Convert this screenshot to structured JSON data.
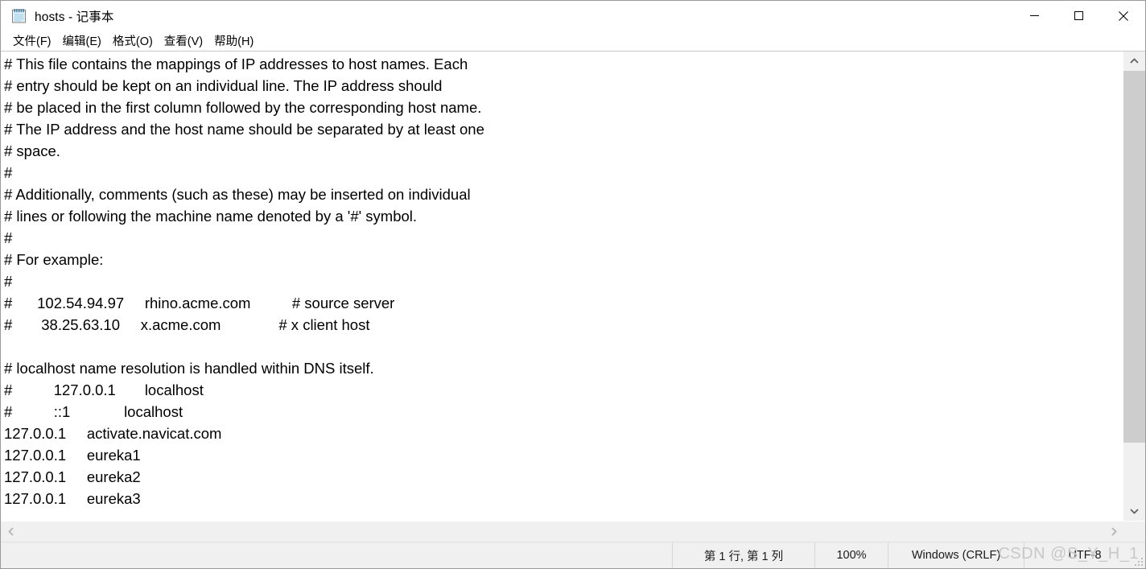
{
  "window": {
    "title": "hosts - 记事本",
    "icon": "notepad-icon",
    "controls": {
      "minimize": "—",
      "maximize": "□",
      "close": "✕"
    }
  },
  "menubar": {
    "items": [
      {
        "label": "文件(F)",
        "name": "menu-file"
      },
      {
        "label": "编辑(E)",
        "name": "menu-edit"
      },
      {
        "label": "格式(O)",
        "name": "menu-format"
      },
      {
        "label": "查看(V)",
        "name": "menu-view"
      },
      {
        "label": "帮助(H)",
        "name": "menu-help"
      }
    ]
  },
  "editor": {
    "lines": [
      "# This file contains the mappings of IP addresses to host names. Each",
      "# entry should be kept on an individual line. The IP address should",
      "# be placed in the first column followed by the corresponding host name.",
      "# The IP address and the host name should be separated by at least one",
      "# space.",
      "#",
      "# Additionally, comments (such as these) may be inserted on individual",
      "# lines or following the machine name denoted by a '#' symbol.",
      "#",
      "# For example:",
      "#",
      "#      102.54.94.97     rhino.acme.com          # source server",
      "#       38.25.63.10     x.acme.com              # x client host",
      "",
      "# localhost name resolution is handled within DNS itself.",
      "#          127.0.0.1       localhost",
      "#          ::1             localhost",
      "127.0.0.1     activate.navicat.com",
      "127.0.0.1     eureka1",
      "127.0.0.1     eureka2",
      "127.0.0.1     eureka3"
    ]
  },
  "scrollbars": {
    "vertical": {
      "up_arrow": "⌃",
      "down_arrow": "⌄"
    },
    "horizontal": {
      "left_arrow": "‹",
      "right_arrow": "›"
    }
  },
  "statusbar": {
    "position": "第 1 行, 第 1 列",
    "zoom": "100%",
    "line_ending": "Windows (CRLF)",
    "encoding": "UTF-8"
  },
  "watermark": {
    "text": "CSDN @S_Y_H_1"
  },
  "colors": {
    "window_bg": "#ffffff",
    "chrome_bg": "#f0f0f0",
    "scroll_thumb": "#cdcdcd",
    "text": "#000000",
    "watermark": "#c8c8c8"
  }
}
